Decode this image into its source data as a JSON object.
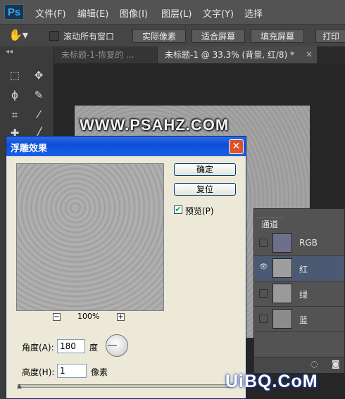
{
  "app": {
    "logo": "Ps"
  },
  "menu": [
    "文件(F)",
    "编辑(E)",
    "图像(I)",
    "图层(L)",
    "文字(Y)",
    "选择"
  ],
  "options_bar": {
    "tool_icon": "hand-icon",
    "scroll_all_label": "滚动所有窗口",
    "buttons": [
      "实际像素",
      "适合屏幕",
      "填充屏幕",
      "打印"
    ]
  },
  "tabs": [
    {
      "label": "未标题-1-恢复的 ...",
      "active": false
    },
    {
      "label": "未标题-1 @ 33.3% (背景, 红/8) *",
      "active": true
    }
  ],
  "canvas": {
    "watermark": "WWW.PSAHZ.COM"
  },
  "dialog": {
    "title": "浮雕效果",
    "ok_label": "确定",
    "reset_label": "复位",
    "preview_label": "预览(P)",
    "preview_checked": true,
    "zoom": "100%",
    "zoom_minus": "−",
    "zoom_plus": "+",
    "angle_label": "角度(A):",
    "angle_value": "180",
    "angle_unit": "度",
    "height_label": "高度(H):",
    "height_value": "1",
    "height_unit": "像素"
  },
  "channels_panel": {
    "tab_label": "通道",
    "channels": [
      {
        "name": "RGB",
        "visible": false,
        "selected": false
      },
      {
        "name": "红",
        "visible": true,
        "selected": true
      },
      {
        "name": "绿",
        "visible": false,
        "selected": false
      },
      {
        "name": "蓝",
        "visible": false,
        "selected": false
      }
    ]
  },
  "footer_watermark": "UiBQ.CoM",
  "colors": {
    "dialog_title": "#0b4fd8",
    "selected_channel": "#4b5a72",
    "ps_blue": "#35a7ff"
  }
}
